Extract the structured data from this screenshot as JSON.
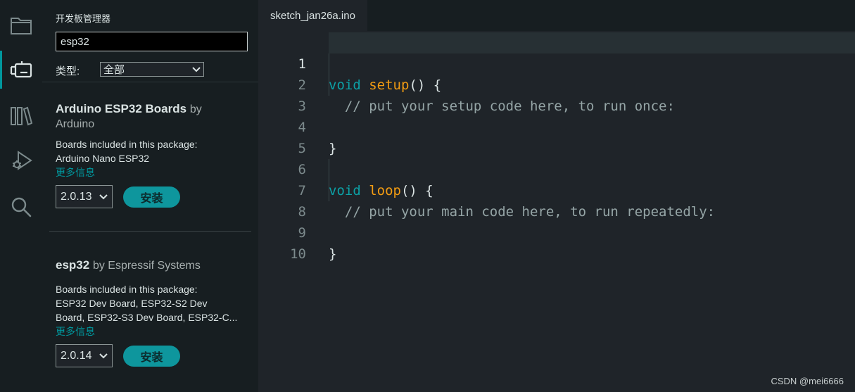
{
  "activity_bar": {
    "items": [
      {
        "icon": "folder-icon"
      },
      {
        "icon": "board-manager-icon",
        "active": true
      },
      {
        "icon": "library-icon"
      },
      {
        "icon": "debug-icon"
      },
      {
        "icon": "search-icon"
      }
    ]
  },
  "board_manager": {
    "title": "开发板管理器",
    "search_value": "esp32",
    "type_label": "类型:",
    "type_value": "全部",
    "packages": [
      {
        "name": "Arduino ESP32 Boards",
        "by": "by",
        "author": "Arduino",
        "boards_heading": "Boards included in this package:",
        "boards": "Arduino Nano ESP32",
        "more_info": "更多信息",
        "version": "2.0.13",
        "install_label": "安装"
      },
      {
        "name": "esp32",
        "by": "by Espressif Systems",
        "boards_heading": "Boards included in this package:",
        "boards_line1": "ESP32 Dev Board, ESP32-S2 Dev",
        "boards_line2": "Board, ESP32-S3 Dev Board, ESP32-C...",
        "more_info": "更多信息",
        "version": "2.0.14",
        "install_label": "安装"
      }
    ]
  },
  "editor": {
    "tab_label": "sketch_jan26a.ino",
    "line_numbers": [
      "1",
      "2",
      "3",
      "4",
      "5",
      "6",
      "7",
      "8",
      "9",
      "10"
    ],
    "code": {
      "l1_kw": "void",
      "l1_fn": "setup",
      "l1_rest": "() {",
      "l2_comment": "// put your setup code here, to run once:",
      "l4_close": "}",
      "l6_kw": "void",
      "l6_fn": "loop",
      "l6_rest": "() {",
      "l7_comment": "// put your main code here, to run repeatedly:",
      "l9_close": "}"
    }
  },
  "watermark": "CSDN @mei6666",
  "colors": {
    "accent": "#00979d",
    "keyword": "#0ca1a6",
    "function": "#f39c12",
    "comment": "#95a5a6",
    "background": "#1f2429",
    "sidebar": "#171e21"
  }
}
